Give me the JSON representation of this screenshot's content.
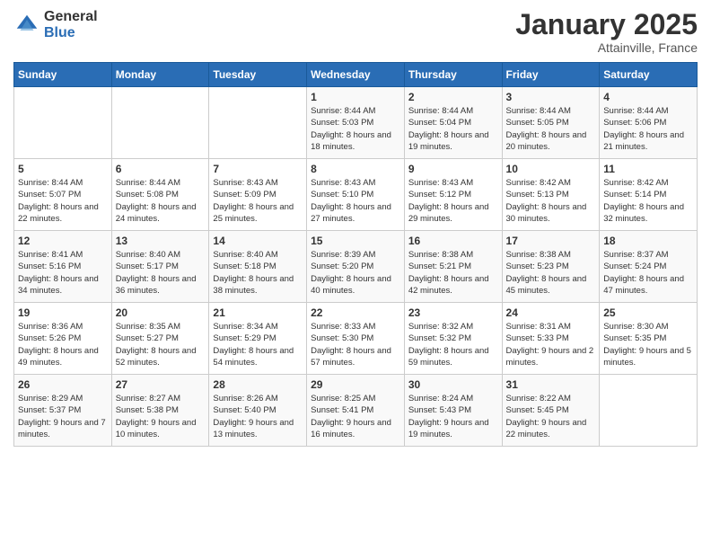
{
  "logo": {
    "general": "General",
    "blue": "Blue"
  },
  "title": "January 2025",
  "location": "Attainville, France",
  "days_of_week": [
    "Sunday",
    "Monday",
    "Tuesday",
    "Wednesday",
    "Thursday",
    "Friday",
    "Saturday"
  ],
  "weeks": [
    [
      {
        "day": "",
        "sunrise": "",
        "sunset": "",
        "daylight": ""
      },
      {
        "day": "",
        "sunrise": "",
        "sunset": "",
        "daylight": ""
      },
      {
        "day": "",
        "sunrise": "",
        "sunset": "",
        "daylight": ""
      },
      {
        "day": "1",
        "sunrise": "Sunrise: 8:44 AM",
        "sunset": "Sunset: 5:03 PM",
        "daylight": "Daylight: 8 hours and 18 minutes."
      },
      {
        "day": "2",
        "sunrise": "Sunrise: 8:44 AM",
        "sunset": "Sunset: 5:04 PM",
        "daylight": "Daylight: 8 hours and 19 minutes."
      },
      {
        "day": "3",
        "sunrise": "Sunrise: 8:44 AM",
        "sunset": "Sunset: 5:05 PM",
        "daylight": "Daylight: 8 hours and 20 minutes."
      },
      {
        "day": "4",
        "sunrise": "Sunrise: 8:44 AM",
        "sunset": "Sunset: 5:06 PM",
        "daylight": "Daylight: 8 hours and 21 minutes."
      }
    ],
    [
      {
        "day": "5",
        "sunrise": "Sunrise: 8:44 AM",
        "sunset": "Sunset: 5:07 PM",
        "daylight": "Daylight: 8 hours and 22 minutes."
      },
      {
        "day": "6",
        "sunrise": "Sunrise: 8:44 AM",
        "sunset": "Sunset: 5:08 PM",
        "daylight": "Daylight: 8 hours and 24 minutes."
      },
      {
        "day": "7",
        "sunrise": "Sunrise: 8:43 AM",
        "sunset": "Sunset: 5:09 PM",
        "daylight": "Daylight: 8 hours and 25 minutes."
      },
      {
        "day": "8",
        "sunrise": "Sunrise: 8:43 AM",
        "sunset": "Sunset: 5:10 PM",
        "daylight": "Daylight: 8 hours and 27 minutes."
      },
      {
        "day": "9",
        "sunrise": "Sunrise: 8:43 AM",
        "sunset": "Sunset: 5:12 PM",
        "daylight": "Daylight: 8 hours and 29 minutes."
      },
      {
        "day": "10",
        "sunrise": "Sunrise: 8:42 AM",
        "sunset": "Sunset: 5:13 PM",
        "daylight": "Daylight: 8 hours and 30 minutes."
      },
      {
        "day": "11",
        "sunrise": "Sunrise: 8:42 AM",
        "sunset": "Sunset: 5:14 PM",
        "daylight": "Daylight: 8 hours and 32 minutes."
      }
    ],
    [
      {
        "day": "12",
        "sunrise": "Sunrise: 8:41 AM",
        "sunset": "Sunset: 5:16 PM",
        "daylight": "Daylight: 8 hours and 34 minutes."
      },
      {
        "day": "13",
        "sunrise": "Sunrise: 8:40 AM",
        "sunset": "Sunset: 5:17 PM",
        "daylight": "Daylight: 8 hours and 36 minutes."
      },
      {
        "day": "14",
        "sunrise": "Sunrise: 8:40 AM",
        "sunset": "Sunset: 5:18 PM",
        "daylight": "Daylight: 8 hours and 38 minutes."
      },
      {
        "day": "15",
        "sunrise": "Sunrise: 8:39 AM",
        "sunset": "Sunset: 5:20 PM",
        "daylight": "Daylight: 8 hours and 40 minutes."
      },
      {
        "day": "16",
        "sunrise": "Sunrise: 8:38 AM",
        "sunset": "Sunset: 5:21 PM",
        "daylight": "Daylight: 8 hours and 42 minutes."
      },
      {
        "day": "17",
        "sunrise": "Sunrise: 8:38 AM",
        "sunset": "Sunset: 5:23 PM",
        "daylight": "Daylight: 8 hours and 45 minutes."
      },
      {
        "day": "18",
        "sunrise": "Sunrise: 8:37 AM",
        "sunset": "Sunset: 5:24 PM",
        "daylight": "Daylight: 8 hours and 47 minutes."
      }
    ],
    [
      {
        "day": "19",
        "sunrise": "Sunrise: 8:36 AM",
        "sunset": "Sunset: 5:26 PM",
        "daylight": "Daylight: 8 hours and 49 minutes."
      },
      {
        "day": "20",
        "sunrise": "Sunrise: 8:35 AM",
        "sunset": "Sunset: 5:27 PM",
        "daylight": "Daylight: 8 hours and 52 minutes."
      },
      {
        "day": "21",
        "sunrise": "Sunrise: 8:34 AM",
        "sunset": "Sunset: 5:29 PM",
        "daylight": "Daylight: 8 hours and 54 minutes."
      },
      {
        "day": "22",
        "sunrise": "Sunrise: 8:33 AM",
        "sunset": "Sunset: 5:30 PM",
        "daylight": "Daylight: 8 hours and 57 minutes."
      },
      {
        "day": "23",
        "sunrise": "Sunrise: 8:32 AM",
        "sunset": "Sunset: 5:32 PM",
        "daylight": "Daylight: 8 hours and 59 minutes."
      },
      {
        "day": "24",
        "sunrise": "Sunrise: 8:31 AM",
        "sunset": "Sunset: 5:33 PM",
        "daylight": "Daylight: 9 hours and 2 minutes."
      },
      {
        "day": "25",
        "sunrise": "Sunrise: 8:30 AM",
        "sunset": "Sunset: 5:35 PM",
        "daylight": "Daylight: 9 hours and 5 minutes."
      }
    ],
    [
      {
        "day": "26",
        "sunrise": "Sunrise: 8:29 AM",
        "sunset": "Sunset: 5:37 PM",
        "daylight": "Daylight: 9 hours and 7 minutes."
      },
      {
        "day": "27",
        "sunrise": "Sunrise: 8:27 AM",
        "sunset": "Sunset: 5:38 PM",
        "daylight": "Daylight: 9 hours and 10 minutes."
      },
      {
        "day": "28",
        "sunrise": "Sunrise: 8:26 AM",
        "sunset": "Sunset: 5:40 PM",
        "daylight": "Daylight: 9 hours and 13 minutes."
      },
      {
        "day": "29",
        "sunrise": "Sunrise: 8:25 AM",
        "sunset": "Sunset: 5:41 PM",
        "daylight": "Daylight: 9 hours and 16 minutes."
      },
      {
        "day": "30",
        "sunrise": "Sunrise: 8:24 AM",
        "sunset": "Sunset: 5:43 PM",
        "daylight": "Daylight: 9 hours and 19 minutes."
      },
      {
        "day": "31",
        "sunrise": "Sunrise: 8:22 AM",
        "sunset": "Sunset: 5:45 PM",
        "daylight": "Daylight: 9 hours and 22 minutes."
      },
      {
        "day": "",
        "sunrise": "",
        "sunset": "",
        "daylight": ""
      }
    ]
  ]
}
